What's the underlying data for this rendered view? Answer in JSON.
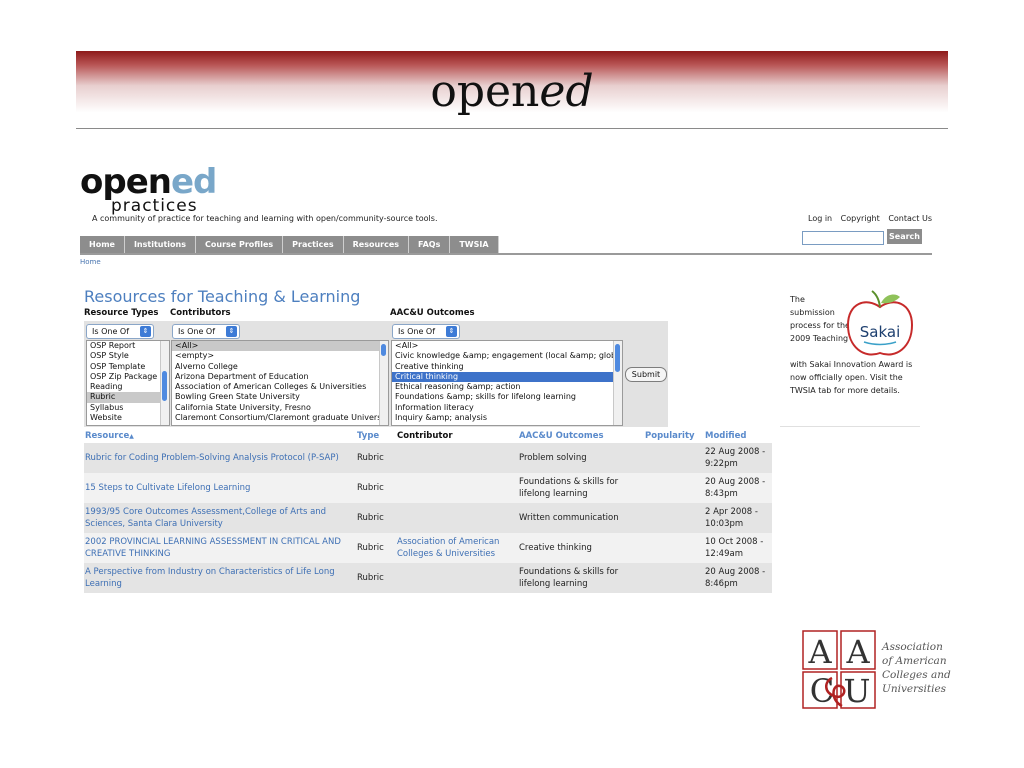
{
  "slide": {
    "title_plain": "open",
    "title_italic": "ed"
  },
  "logo": {
    "word_a": "open",
    "word_b": "ed",
    "sub": "practices"
  },
  "tagline": "A community of practice for teaching and learning with open/community-source tools.",
  "top_links": [
    "Log in",
    "Copyright",
    "Contact Us"
  ],
  "search": {
    "button": "Search",
    "value": ""
  },
  "nav": [
    "Home",
    "Institutions",
    "Course Profiles",
    "Practices",
    "Resources",
    "FAQs",
    "TWSIA"
  ],
  "breadcrumb": "Home",
  "page_title": "Resources for Teaching & Learning",
  "filters": {
    "labels": {
      "types": "Resource Types",
      "contributors": "Contributors",
      "outcomes": "AAC&U Outcomes"
    },
    "operator": "Is One Of",
    "types": [
      "OSP Report",
      "OSP Style",
      "OSP Template",
      "OSP Zip Package",
      "Reading",
      "Rubric",
      "Syllabus",
      "Website"
    ],
    "contributors": [
      "<All>",
      "<empty>",
      "Alverno College",
      "Arizona Department of Education",
      "Association of American Colleges & Universities",
      "Bowling Green State University",
      "California State University, Fresno",
      "Claremont Consortium/Claremont graduate University"
    ],
    "outcomes": [
      "<All>",
      "Civic knowledge &amp; engagement (local &amp; global)",
      "Creative thinking",
      "Critical thinking",
      "Ethical reasoning &amp; action",
      "Foundations &amp; skills for lifelong learning",
      "Information literacy",
      "Inquiry &amp; analysis"
    ],
    "submit": "Submit"
  },
  "table": {
    "headers": {
      "resource": "Resource",
      "sort": "▲",
      "type": "Type",
      "contributor": "Contributor",
      "outcomes": "AAC&U Outcomes",
      "popularity": "Popularity",
      "modified": "Modified"
    },
    "rows": [
      {
        "resource": "Rubric for Coding Problem-Solving Analysis Protocol (P-SAP)",
        "type": "Rubric",
        "contributor": "",
        "outcome": "Problem solving",
        "modified": "22 Aug 2008 - 9:22pm"
      },
      {
        "resource": "15 Steps to Cultivate Lifelong Learning",
        "type": "Rubric",
        "contributor": "",
        "outcome": "Foundations & skills for lifelong learning",
        "modified": "20 Aug 2008 - 8:43pm"
      },
      {
        "resource": "1993/95 Core Outcomes Assessment,College of Arts and Sciences, Santa Clara University",
        "type": "Rubric",
        "contributor": "",
        "outcome": "Written communication",
        "modified": "2 Apr 2008 - 10:03pm"
      },
      {
        "resource": "2002 PROVINCIAL LEARNING ASSESSMENT IN CRITICAL AND CREATIVE THINKING",
        "type": "Rubric",
        "contributor": "Association of American Colleges & Universities",
        "outcome": "Creative thinking",
        "modified": "10 Oct 2008 - 12:49am"
      },
      {
        "resource": "A Perspective from Industry on Characteristics of Life Long Learning",
        "type": "Rubric",
        "contributor": "",
        "outcome": "Foundations & skills for lifelong learning",
        "modified": "20 Aug 2008 - 8:46pm"
      }
    ]
  },
  "award": {
    "text_a": "The submission process for the 2009 Teaching",
    "text_b": "with Sakai Innovation Award is now officially open. Visit the TWSIA tab for more details.",
    "badge": "Sakai"
  },
  "aacu": {
    "line1": "Association",
    "line2": "of American",
    "line3": "Colleges and",
    "line4": "Universities",
    "letters_a": "A",
    "letters_b": "A",
    "letters_c": "C",
    "letters_d": "U"
  }
}
